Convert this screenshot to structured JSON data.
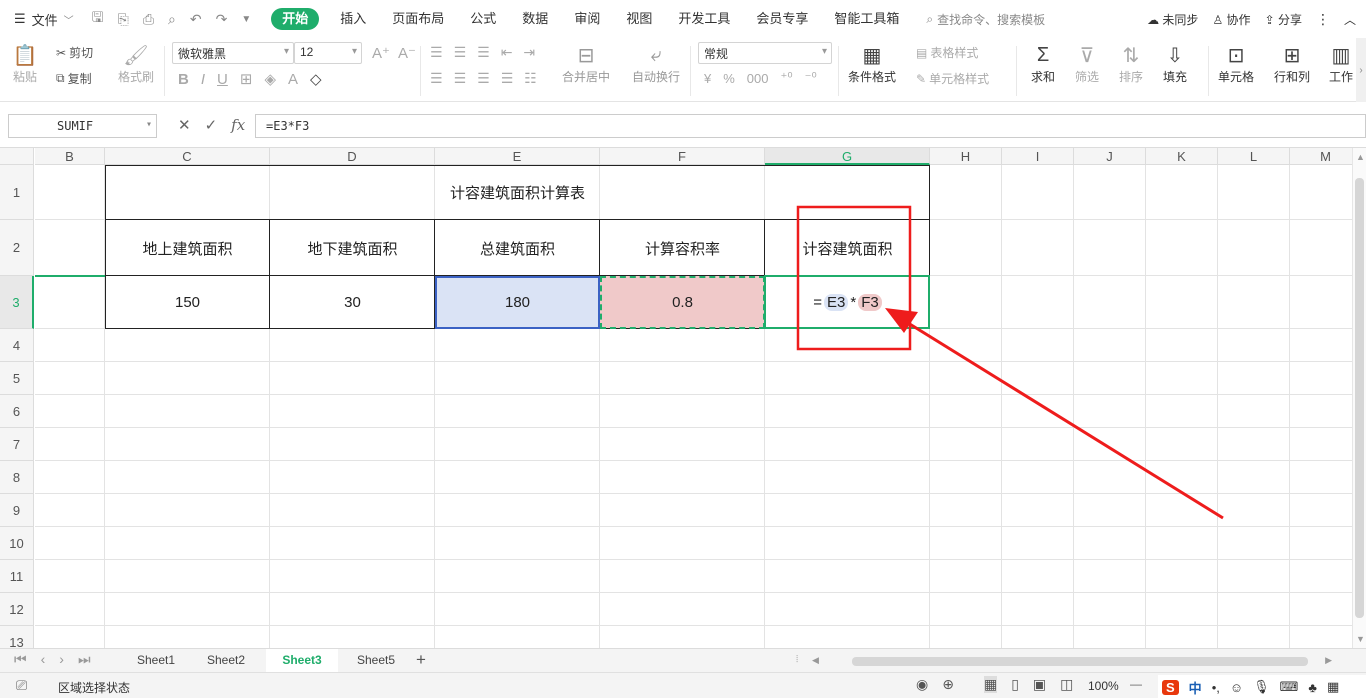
{
  "topbar": {
    "file_label": "文件",
    "tabs": [
      "开始",
      "插入",
      "页面布局",
      "公式",
      "数据",
      "审阅",
      "视图",
      "开发工具",
      "会员专享",
      "智能工具箱"
    ],
    "search_placeholder": "查找命令、搜索模板",
    "sync_label": "未同步",
    "collab_label": "协作",
    "share_label": "分享"
  },
  "ribbon": {
    "paste": "粘贴",
    "cut": "剪切",
    "copy": "复制",
    "format_painter": "格式刷",
    "font_name": "微软雅黑",
    "font_size": "12",
    "merge_center": "合并居中",
    "wrap_text": "自动换行",
    "number_format": "常规",
    "conditional_format": "条件格式",
    "table_style": "表格样式",
    "cell_style": "单元格样式",
    "sum": "求和",
    "filter": "筛选",
    "sort": "排序",
    "fill": "填充",
    "cell": "单元格",
    "row_col": "行和列",
    "worksheet": "工作"
  },
  "formula_bar": {
    "name_box": "SUMIF",
    "formula": "=E3*F3"
  },
  "grid": {
    "columns": [
      "B",
      "C",
      "D",
      "E",
      "F",
      "G",
      "H",
      "I",
      "J",
      "K",
      "L",
      "M"
    ],
    "rows": [
      "1",
      "2",
      "3",
      "4",
      "5",
      "6",
      "7",
      "8",
      "9",
      "10",
      "11",
      "12",
      "13"
    ],
    "active_col": "G",
    "active_row": "3",
    "title": "计容建筑面积计算表",
    "headers": [
      "地上建筑面积",
      "地下建筑面积",
      "总建筑面积",
      "计算容积率",
      "计容建筑面积"
    ],
    "values": [
      "150",
      "30",
      "180",
      "0.8"
    ],
    "formula_parts": [
      "=",
      "E3",
      "*",
      "F3"
    ]
  },
  "sheets": {
    "tabs": [
      "Sheet1",
      "Sheet2",
      "Sheet3",
      "Sheet5"
    ],
    "active": "Sheet3"
  },
  "status": {
    "mode": "区域选择状态",
    "zoom": "100%"
  },
  "colors": {
    "accent": "#1fad6b",
    "ref_e3": "#dae3f5",
    "ref_f3": "#f0c9c9",
    "annotation": "#ee1c1c"
  }
}
